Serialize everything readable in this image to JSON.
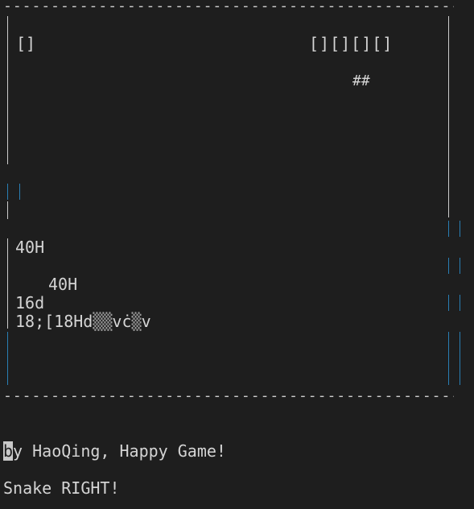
{
  "game": {
    "border_line": "----------------------------------------------------------------",
    "food": "[]",
    "snake_body": "[][][][]",
    "snake_head": "##",
    "garbage": {
      "line1": "40H",
      "line2": "40H",
      "line3": "16d",
      "line4_prefix": "18;[18Hd",
      "line4_shade1": "▒▒",
      "line4_mid": "vċ",
      "line4_shade2": "▒",
      "line4_suffix": "v"
    },
    "credit_cursor": "b",
    "credit_rest": "y HaoQing, Happy Game!",
    "status": "Snake RIGHT!"
  },
  "colors": {
    "background": "#1e1e1e",
    "text": "#d4d4d4",
    "border_white": "#cccccc",
    "border_blue": "#2a7fb5"
  }
}
